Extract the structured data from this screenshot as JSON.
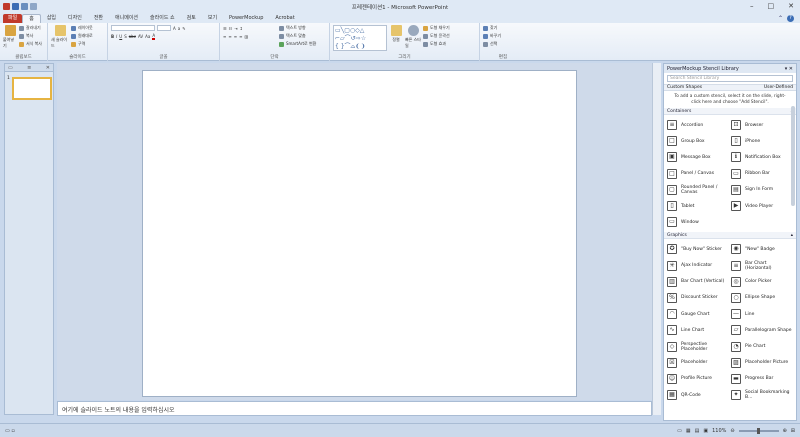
{
  "window": {
    "title": "프레젠테이션1 - Microsoft PowerPoint",
    "min": "–",
    "max": "□",
    "close": "✕"
  },
  "tabs": [
    {
      "label": "파일",
      "kind": "file"
    },
    {
      "label": "홈",
      "kind": "active"
    },
    {
      "label": "삽입",
      "kind": ""
    },
    {
      "label": "디자인",
      "kind": ""
    },
    {
      "label": "전환",
      "kind": ""
    },
    {
      "label": "애니메이션",
      "kind": ""
    },
    {
      "label": "슬라이드 쇼",
      "kind": ""
    },
    {
      "label": "검토",
      "kind": ""
    },
    {
      "label": "보기",
      "kind": ""
    },
    {
      "label": "PowerMockup",
      "kind": ""
    },
    {
      "label": "Acrobat",
      "kind": ""
    }
  ],
  "ribbon": {
    "clipboard": {
      "name": "클립보드",
      "paste": "붙여넣기",
      "cut": "잘라내기",
      "copy": "복사",
      "format": "서식 복사"
    },
    "slides": {
      "name": "슬라이드",
      "new": "새 슬라이드",
      "layout": "레이아웃",
      "reset": "원래대로",
      "section": "구역"
    },
    "font": {
      "name": "글꼴"
    },
    "paragraph": {
      "name": "단락",
      "textdir": "텍스트 방향",
      "align": "텍스트 맞춤",
      "smartart": "SmartArt로 변환"
    },
    "drawing": {
      "name": "그리기",
      "arrange": "정렬",
      "quick": "빠른 스타일",
      "fill": "도형 채우기",
      "outline": "도형 윤곽선",
      "effect": "도형 효과"
    },
    "editing": {
      "name": "편집",
      "find": "찾기",
      "replace": "바꾸기",
      "select": "선택"
    }
  },
  "slides_panel": {
    "tab_close": "✕",
    "slide_number": "1"
  },
  "notes": {
    "placeholder": "여기에 슬라이드 노트의 내용을 입력하십시오"
  },
  "status": {
    "zoom": "110%"
  },
  "stencil": {
    "title": "PowerMockup Stencil Library",
    "search_placeholder": "Search Stencil Library",
    "custom_shapes": "Custom Shapes",
    "user_defined": "User-Defined",
    "hint": "To add a custom stencil, select it on the slide, right-click here and choose \"Add Stencil\".",
    "sections": [
      {
        "name": "Containers",
        "items": [
          {
            "label": "Accordion",
            "icon": "≡"
          },
          {
            "label": "Browser",
            "icon": "⊡"
          },
          {
            "label": "Group Box",
            "icon": "□"
          },
          {
            "label": "iPhone",
            "icon": "▯"
          },
          {
            "label": "Message Box",
            "icon": "▣"
          },
          {
            "label": "Notification Box",
            "icon": "ℹ"
          },
          {
            "label": "Panel / Canvas",
            "icon": "□"
          },
          {
            "label": "Ribbon Bar",
            "icon": "▭"
          },
          {
            "label": "Rounded Panel / Canvas",
            "icon": "▢"
          },
          {
            "label": "Sign In Form",
            "icon": "▤"
          },
          {
            "label": "Tablet",
            "icon": "▯"
          },
          {
            "label": "Video Player",
            "icon": "▶"
          },
          {
            "label": "Window",
            "icon": "▭"
          }
        ]
      },
      {
        "name": "Graphics",
        "items": [
          {
            "label": "\"Buy Now\" Sticker",
            "icon": "✪"
          },
          {
            "label": "\"New\" Badge",
            "icon": "◉"
          },
          {
            "label": "Ajax Indicator",
            "icon": "✳"
          },
          {
            "label": "Bar Chart (Horizontal)",
            "icon": "≡"
          },
          {
            "label": "Bar Chart (Vertical)",
            "icon": "▥"
          },
          {
            "label": "Color Picker",
            "icon": "◎"
          },
          {
            "label": "Discount Sticker",
            "icon": "%"
          },
          {
            "label": "Ellipse Shape",
            "icon": "○"
          },
          {
            "label": "Gauge Chart",
            "icon": "◠"
          },
          {
            "label": "Line",
            "icon": "—"
          },
          {
            "label": "Line Chart",
            "icon": "∿"
          },
          {
            "label": "Parallelogram Shape",
            "icon": "▱"
          },
          {
            "label": "Perspective Placeholder",
            "icon": "◇"
          },
          {
            "label": "Pie Chart",
            "icon": "◔"
          },
          {
            "label": "Placeholder",
            "icon": "☒"
          },
          {
            "label": "Placeholder Picture",
            "icon": "▨"
          },
          {
            "label": "Profile Picture",
            "icon": "☺"
          },
          {
            "label": "Progress Bar",
            "icon": "▬"
          },
          {
            "label": "QR-Code",
            "icon": "▦"
          },
          {
            "label": "Social Bookmarking B...",
            "icon": "✦"
          }
        ]
      }
    ]
  }
}
